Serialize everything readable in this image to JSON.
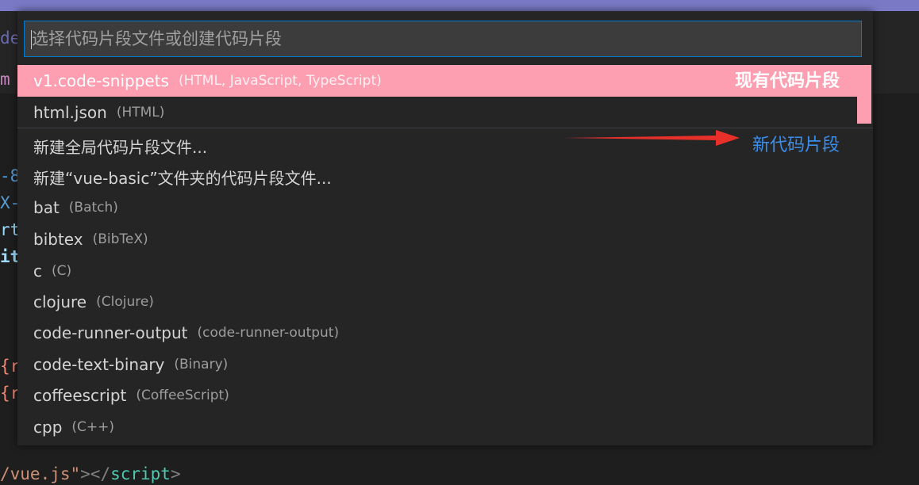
{
  "colors": {
    "accent_pink": "#fd9fb1",
    "annotation_blue": "#3b8eea",
    "arrow_red": "#e8302a"
  },
  "background_code": {
    "frag_de": "de",
    "frag_m": "m",
    "frag_8": "-8",
    "frag_x": "X-",
    "frag_rt": "rt",
    "frag_it": "it",
    "frag_brace1": "{r",
    "frag_brace2": "{r",
    "bottom_line": {
      "path": "/vue.js\"",
      "close_open": "></",
      "tag": "script",
      "close": ">"
    }
  },
  "quick_pick": {
    "placeholder": "选择代码片段文件或创建代码片段",
    "items": [
      {
        "label": "v1.code-snippets",
        "description": "(HTML, JavaScript, TypeScript)"
      },
      {
        "label": "html.json",
        "description": "(HTML)"
      },
      {
        "label": "新建全局代码片段文件...",
        "description": ""
      },
      {
        "label": "新建“vue-basic”文件夹的代码片段文件...",
        "description": ""
      },
      {
        "label": "bat",
        "description": "(Batch)"
      },
      {
        "label": "bibtex",
        "description": "(BibTeX)"
      },
      {
        "label": "c",
        "description": "(C)"
      },
      {
        "label": "clojure",
        "description": "(Clojure)"
      },
      {
        "label": "code-runner-output",
        "description": "(code-runner-output)"
      },
      {
        "label": "code-text-binary",
        "description": "(Binary)"
      },
      {
        "label": "coffeescript",
        "description": "(CoffeeScript)"
      },
      {
        "label": "cpp",
        "description": "(C++)"
      }
    ]
  },
  "annotations": {
    "existing": "现有代码片段",
    "new": "新代码片段"
  }
}
